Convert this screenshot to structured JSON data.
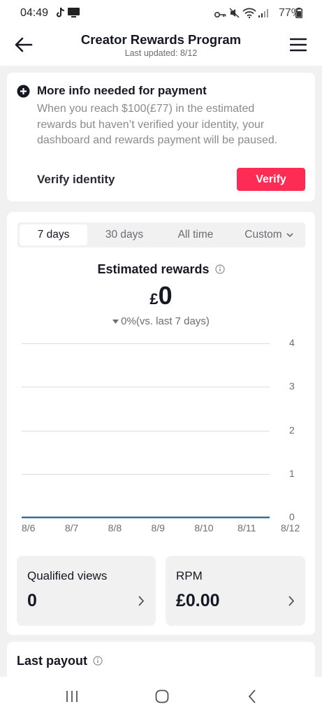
{
  "status_bar": {
    "time": "04:49",
    "battery": "77%"
  },
  "header": {
    "title": "Creator Rewards Program",
    "subtitle": "Last updated: 8/12"
  },
  "alert": {
    "title": "More info needed for payment",
    "body_line1": "When you reach $100(£77) in the estimated",
    "body_line2": "rewards but haven’t verified your identity, your",
    "body_line3": "dashboard and rewards payment will be paused.",
    "action_label": "Verify identity",
    "button_label": "Verify"
  },
  "tabs": [
    "7 days",
    "30 days",
    "All time",
    "Custom"
  ],
  "estimate": {
    "label": "Estimated rewards",
    "currency": "£",
    "amount": "0",
    "change": "0%",
    "change_note": "(vs. last 7 days)"
  },
  "chart_data": {
    "type": "line",
    "x": [
      "8/6",
      "8/7",
      "8/8",
      "8/9",
      "8/10",
      "8/11",
      "8/12"
    ],
    "series": [
      {
        "values": [
          0,
          0,
          0,
          0,
          0,
          0,
          0
        ]
      }
    ],
    "y_ticks": [
      "4",
      "3",
      "2",
      "1",
      "0"
    ],
    "ylim": [
      0,
      4
    ],
    "grid": true,
    "line_color": "#3d6a97"
  },
  "stats": {
    "views_label": "Qualified views",
    "views_value": "0",
    "rpm_label": "RPM",
    "rpm_value": "£0.00"
  },
  "last_payout": {
    "label": "Last payout"
  },
  "colors": {
    "accent": "#fe2c55",
    "text": "#161823",
    "muted": "#6b6c73"
  }
}
